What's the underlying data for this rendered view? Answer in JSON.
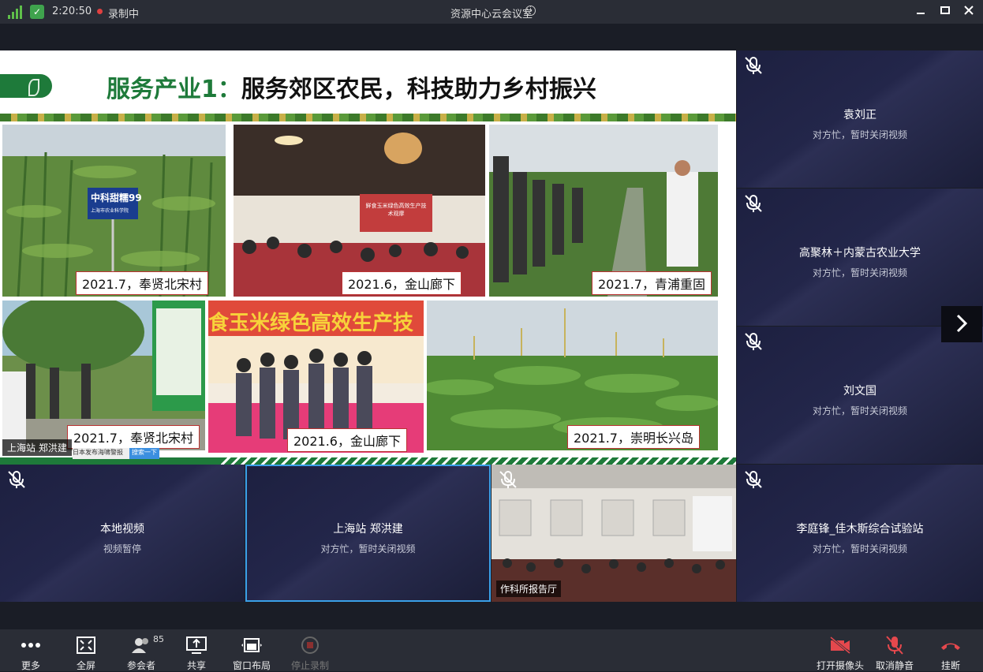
{
  "titlebar": {
    "time": "2:20:50",
    "recording_label": "录制中",
    "title": "资源中心云会议室"
  },
  "slide": {
    "title_highlight": "服务产业1：",
    "title_rest": "服务郊区农民，科技助力乡村振兴",
    "sign_text_1": "中科甜糯99",
    "sign_text_2": "上海市农业科学院",
    "screen_text": "鲜食玉米绿色高效生产技术观摩",
    "banner_text": "食玉米绿色高效生产技",
    "captions": [
      "2021.7，奉贤北宋村",
      "2021.6，金山廊下",
      "2021.7，青浦重固",
      "2021.7，奉贤北宋村",
      "2021.6，金山廊下",
      "2021.7，崇明长兴岛"
    ]
  },
  "presenter": {
    "label": "上海站 郑洪建",
    "ticker_text": "日本发布海啸警报",
    "ticker_search": "搜索一下"
  },
  "tiles": [
    {
      "name": "袁刘正",
      "status": "对方忙，暂时关闭视频"
    },
    {
      "name": "高聚林＋内蒙古农业大学",
      "status": "对方忙，暂时关闭视频"
    },
    {
      "name": "刘文国",
      "status": "对方忙，暂时关闭视频"
    },
    {
      "name": "本地视频",
      "status": "视频暂停"
    },
    {
      "name": "上海站 郑洪建",
      "status": "对方忙，暂时关闭视频"
    },
    {
      "name": "作科所报告厅",
      "status": ""
    },
    {
      "name": "李庭锋_佳木斯综合试验站",
      "status": "对方忙，暂时关闭视频"
    }
  ],
  "toolbar": {
    "more": "更多",
    "fullscreen": "全屏",
    "participants": "参会者",
    "participant_count": "85",
    "share": "共享",
    "layout": "窗口布局",
    "stop_record": "停止录制",
    "open_camera": "打开摄像头",
    "unmute": "取消静音",
    "hangup": "挂断"
  },
  "colors": {
    "accent_green": "#1e7a3a",
    "active_border": "#3aa0e8",
    "hangup_red": "#e5484d"
  }
}
